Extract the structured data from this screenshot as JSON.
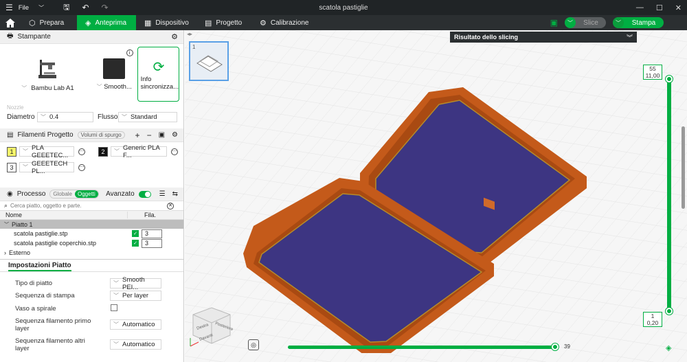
{
  "titlebar": {
    "menu_label": "File",
    "title": "scatola pastiglie",
    "window_min": "—",
    "window_max": "☐",
    "window_close": "✕"
  },
  "nav": {
    "tabs": [
      {
        "label": "Prepara"
      },
      {
        "label": "Anteprima"
      },
      {
        "label": "Dispositivo"
      },
      {
        "label": "Progetto"
      },
      {
        "label": "Calibrazione"
      }
    ],
    "slice_label": "Slice",
    "print_label": "Stampa",
    "accent": "#00ae42"
  },
  "printer": {
    "section_title": "Stampante",
    "printer_name": "Bambu Lab A1",
    "plate_name": "Smooth...",
    "sync_label_1": "Info",
    "sync_label_2": "sincronizza...",
    "nozzle_label": "Nozzle",
    "diameter_label": "Diametro",
    "diameter_value": "0.4",
    "flow_label": "Flusso",
    "flow_value": "Standard"
  },
  "filaments": {
    "section_title": "Filamenti Progetto",
    "purge_label": "Volumi di spurgo",
    "items": [
      {
        "num": "1",
        "name": "PLA GEEETEC...",
        "color": "#f5f56a"
      },
      {
        "num": "2",
        "name": "Generic PLA F...",
        "color": "#1a1a1a"
      },
      {
        "num": "3",
        "name": "GEEETECH PL...",
        "color": "#ffffff"
      }
    ]
  },
  "process": {
    "section_title": "Processo",
    "seg_global": "Globale",
    "seg_objects": "Oggetti",
    "advanced_label": "Avanzato",
    "search_placeholder": "Cerca piatto, oggetto e parte.",
    "col_name": "Nome",
    "col_fil": "Fila.",
    "plate_label": "Piatto 1",
    "objects": [
      {
        "name": "scatola pastiglie.stp",
        "fil": "3"
      },
      {
        "name": "scatola pastiglie coperchio.stp",
        "fil": "3"
      }
    ],
    "external_label": "Esterno"
  },
  "plate_settings": {
    "tab_label": "Impostazioni Piatto",
    "rows": [
      {
        "label": "Tipo di piatto",
        "value": "Smooth PEI..."
      },
      {
        "label": "Sequenza di stampa",
        "value": "Per layer"
      },
      {
        "label": "Vaso a spirale",
        "value": ""
      },
      {
        "label": "Sequenza filamento primo",
        "label2": "layer",
        "value": "Automatico"
      },
      {
        "label": "Sequenza filamento altri",
        "label2": "layer",
        "value": "Automatico"
      }
    ]
  },
  "preview": {
    "slicing_label": "Risultato dello slicing",
    "thumb_num": "1",
    "layer_top": "55",
    "height_top": "11,00",
    "layer_bottom": "1",
    "height_bottom": "0,20",
    "hslider_value": "39",
    "cube_labels": {
      "front": "Davanti",
      "back": "Posteriore",
      "left": "Destra"
    }
  }
}
